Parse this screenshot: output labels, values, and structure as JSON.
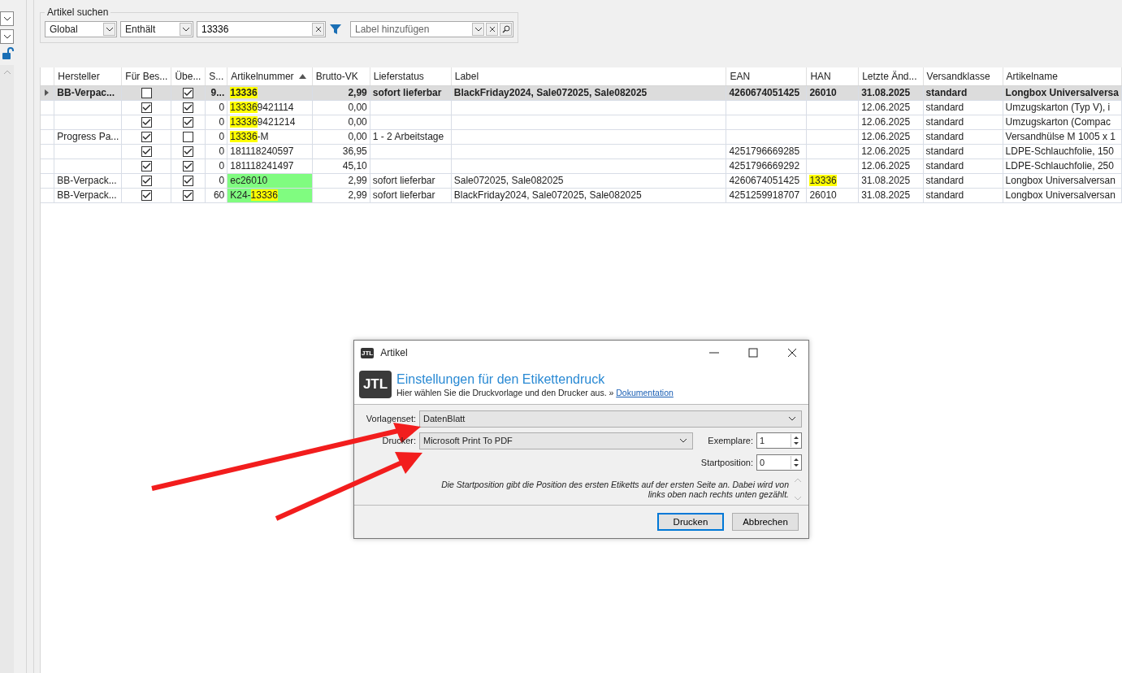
{
  "search": {
    "title": "Artikel suchen",
    "scope": "Global",
    "mode": "Enthält",
    "query": "13336",
    "label_placeholder": "Label hinzufügen"
  },
  "table": {
    "columns": [
      {
        "label": "Hersteller",
        "sorted": false
      },
      {
        "label": "Für Bes...",
        "sorted": false
      },
      {
        "label": "Übe...",
        "sorted": false
      },
      {
        "label": "S...",
        "sorted": false
      },
      {
        "label": "Artikelnummer",
        "sorted": true
      },
      {
        "label": "Brutto-VK",
        "sorted": false
      },
      {
        "label": "Lieferstatus",
        "sorted": false
      },
      {
        "label": "Label",
        "sorted": false
      },
      {
        "label": "EAN",
        "sorted": false
      },
      {
        "label": "HAN",
        "sorted": false
      },
      {
        "label": "Letzte Änd...",
        "sorted": false
      },
      {
        "label": "Versandklasse",
        "sorted": false
      },
      {
        "label": "Artikelname",
        "sorted": false
      }
    ],
    "rows": [
      {
        "selected": true,
        "hersteller": "BB-Verpac...",
        "fuer_bestellung": false,
        "ueber": true,
        "s": "9...",
        "artikelnummer": [
          {
            "text": "13336",
            "highlight": true
          }
        ],
        "marked": false,
        "brutto": "2,99",
        "lieferstatus": "sofort lieferbar",
        "label": "BlackFriday2024, Sale072025, Sale082025",
        "ean": "4260674051425",
        "han": [
          {
            "text": "26010",
            "highlight": false
          }
        ],
        "geaendert": "31.08.2025",
        "versandklasse": "standard",
        "artikelname": "Longbox Universalversa"
      },
      {
        "selected": false,
        "hersteller": "",
        "fuer_bestellung": true,
        "ueber": true,
        "s": "0",
        "artikelnummer": [
          {
            "text": "13336",
            "highlight": true
          },
          {
            "text": "9421114",
            "highlight": false
          }
        ],
        "marked": false,
        "brutto": "0,00",
        "lieferstatus": "",
        "label": "",
        "ean": "",
        "han": [],
        "geaendert": "12.06.2025",
        "versandklasse": "standard",
        "artikelname": "Umzugskarton (Typ V), i"
      },
      {
        "selected": false,
        "hersteller": "",
        "fuer_bestellung": true,
        "ueber": true,
        "s": "0",
        "artikelnummer": [
          {
            "text": "13336",
            "highlight": true
          },
          {
            "text": "9421214",
            "highlight": false
          }
        ],
        "marked": false,
        "brutto": "0,00",
        "lieferstatus": "",
        "label": "",
        "ean": "",
        "han": [],
        "geaendert": "12.06.2025",
        "versandklasse": "standard",
        "artikelname": "Umzugskarton (Compac"
      },
      {
        "selected": false,
        "hersteller": "Progress Pa...",
        "fuer_bestellung": true,
        "ueber": false,
        "s": "0",
        "artikelnummer": [
          {
            "text": "13336",
            "highlight": true
          },
          {
            "text": "-M",
            "highlight": false
          }
        ],
        "marked": false,
        "brutto": "0,00",
        "lieferstatus": "1 - 2 Arbeitstage",
        "label": "",
        "ean": "",
        "han": [],
        "geaendert": "12.06.2025",
        "versandklasse": "standard",
        "artikelname": "Versandhülse M 1005 x 1"
      },
      {
        "selected": false,
        "hersteller": "",
        "fuer_bestellung": true,
        "ueber": true,
        "s": "0",
        "artikelnummer": [
          {
            "text": "181118240597",
            "highlight": false
          }
        ],
        "marked": false,
        "brutto": "36,95",
        "lieferstatus": "",
        "label": "",
        "ean": "4251796669285",
        "han": [],
        "geaendert": "12.06.2025",
        "versandklasse": "standard",
        "artikelname": "LDPE-Schlauchfolie, 150"
      },
      {
        "selected": false,
        "hersteller": "",
        "fuer_bestellung": true,
        "ueber": true,
        "s": "0",
        "artikelnummer": [
          {
            "text": "181118241497",
            "highlight": false
          }
        ],
        "marked": false,
        "brutto": "45,10",
        "lieferstatus": "",
        "label": "",
        "ean": "4251796669292",
        "han": [],
        "geaendert": "12.06.2025",
        "versandklasse": "standard",
        "artikelname": "LDPE-Schlauchfolie, 250"
      },
      {
        "selected": false,
        "hersteller": "BB-Verpack...",
        "fuer_bestellung": true,
        "ueber": true,
        "s": "0",
        "artikelnummer": [
          {
            "text": "ec26010",
            "highlight": false
          }
        ],
        "marked": true,
        "brutto": "2,99",
        "lieferstatus": "sofort lieferbar",
        "label": "Sale072025, Sale082025",
        "ean": "4260674051425",
        "han": [
          {
            "text": "13336",
            "highlight": true
          }
        ],
        "geaendert": "31.08.2025",
        "versandklasse": "standard",
        "artikelname": "Longbox Universalversan"
      },
      {
        "selected": false,
        "hersteller": "BB-Verpack...",
        "fuer_bestellung": true,
        "ueber": true,
        "s": "60",
        "artikelnummer": [
          {
            "text": "K24-",
            "highlight": false
          },
          {
            "text": "13336",
            "highlight": true
          }
        ],
        "marked": true,
        "brutto": "2,99",
        "lieferstatus": "sofort lieferbar",
        "label": "BlackFriday2024, Sale072025, Sale082025",
        "ean": "4251259918707",
        "han": [
          {
            "text": "26010",
            "highlight": false
          }
        ],
        "geaendert": "31.08.2025",
        "versandklasse": "standard",
        "artikelname": "Longbox Universalversan"
      }
    ]
  },
  "dialog": {
    "title": "Artikel",
    "title_logo": "JTL",
    "logo": "JTL",
    "heading": "Einstellungen für den Etikettendruck",
    "subtitle": "Hier wählen Sie die Druckvorlage und den Drucker aus. »",
    "link": "Dokumentation",
    "vorlagenset_label": "Vorlagenset:",
    "vorlagenset": "DatenBlatt",
    "drucker_label": "Drucker:",
    "drucker": "Microsoft Print To PDF",
    "exemplare_label": "Exemplare:",
    "exemplare": "1",
    "startposition_label": "Startposition:",
    "startposition": "0",
    "hint": "Die Startposition gibt die Position des ersten Etiketts auf der ersten Seite an. Dabei wird von links oben nach rechts unten gezählt.",
    "buttons": [
      {
        "label": "Drucken",
        "default": true
      },
      {
        "label": "Abbrechen",
        "default": false
      }
    ]
  }
}
